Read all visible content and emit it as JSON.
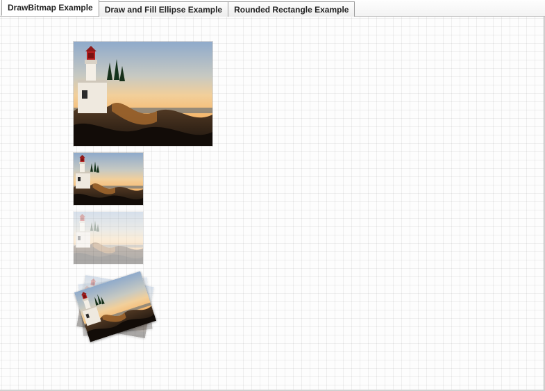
{
  "tabs": [
    {
      "label": "DrawBitmap Example",
      "active": true
    },
    {
      "label": "Draw and Fill Ellipse Example",
      "active": false
    },
    {
      "label": "Rounded Rectangle Example",
      "active": false
    }
  ],
  "image_desc": "lighthouse-sunset",
  "icons": {
    "photo": "lighthouse-photo"
  }
}
